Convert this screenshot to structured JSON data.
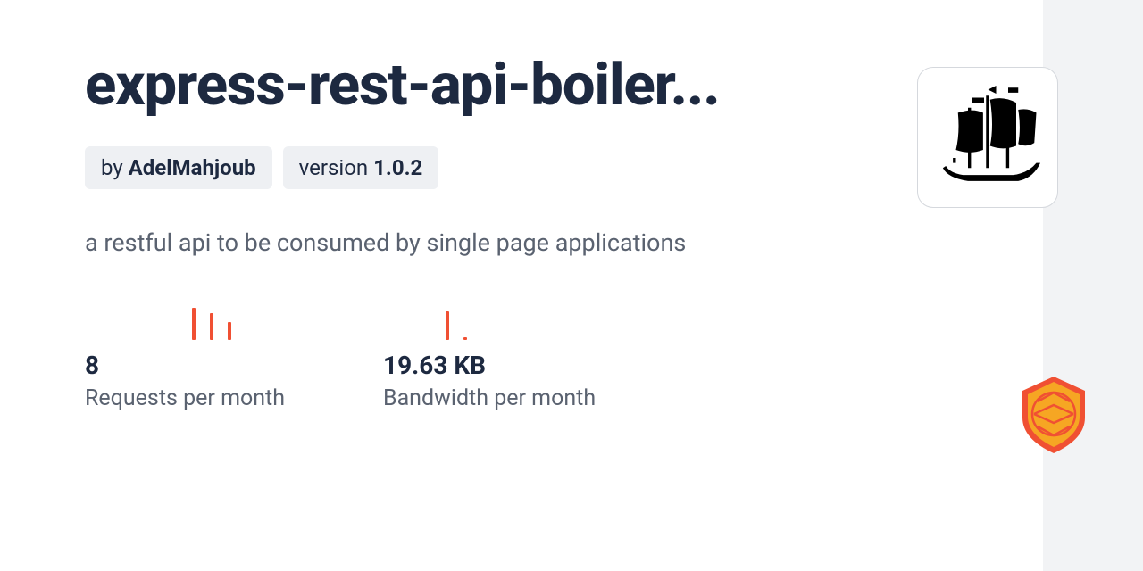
{
  "package": {
    "title_display": "express-rest-api-boiler...",
    "author_prefix": "by ",
    "author": "AdelMahjoub",
    "version_prefix": "version ",
    "version": "1.0.2",
    "description": "a restful api to be consumed by single page applications"
  },
  "stats": {
    "requests": {
      "value": "8",
      "label": "Requests per month",
      "spark_heights": [
        36,
        30,
        20
      ]
    },
    "bandwidth": {
      "value": "19.63 KB",
      "label": "Bandwidth per month",
      "spark_heights": [
        32,
        3
      ]
    }
  },
  "colors": {
    "accent": "#f05033",
    "text_dark": "#1d2940",
    "text_muted": "#5a6270",
    "badge_bg": "#eef0f3"
  }
}
